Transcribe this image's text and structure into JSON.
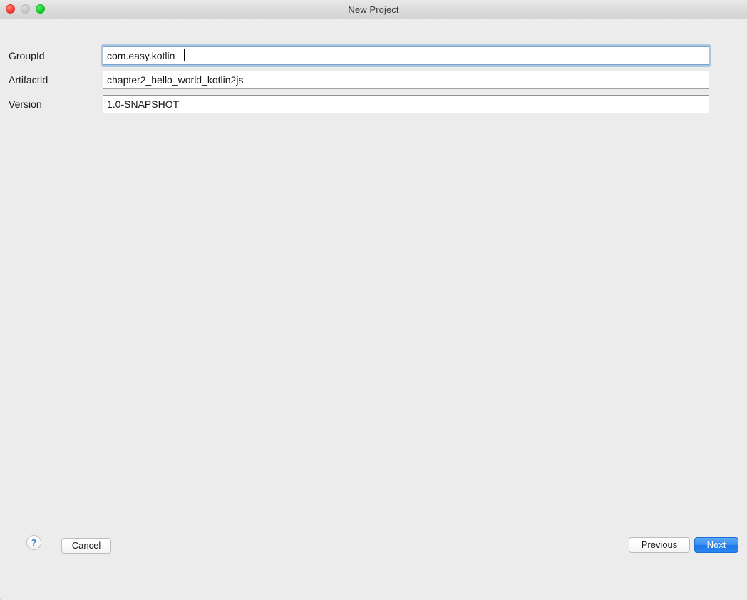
{
  "window": {
    "title": "New Project",
    "traffic_lights": [
      {
        "name": "close",
        "color": "#fb3b30",
        "enabled": true
      },
      {
        "name": "minimize",
        "color": "#c8c8c8",
        "enabled": false
      },
      {
        "name": "zoom",
        "color": "#15cc2c",
        "enabled": true
      }
    ],
    "background_color": "#ececec"
  },
  "form": {
    "fields": [
      {
        "label": "GroupId",
        "value": "com.easy.kotlin",
        "placeholder": "",
        "focused": true
      },
      {
        "label": "ArtifactId",
        "value": "chapter2_hello_world_kotlin2js",
        "placeholder": "",
        "focused": false
      },
      {
        "label": "Version",
        "value": "1.0-SNAPSHOT",
        "placeholder": "",
        "focused": false
      }
    ]
  },
  "footer": {
    "help_label": "?",
    "cancel_label": "Cancel",
    "previous_label": "Previous",
    "next_label": "Next",
    "next_accent_color": "#2b86ef"
  }
}
